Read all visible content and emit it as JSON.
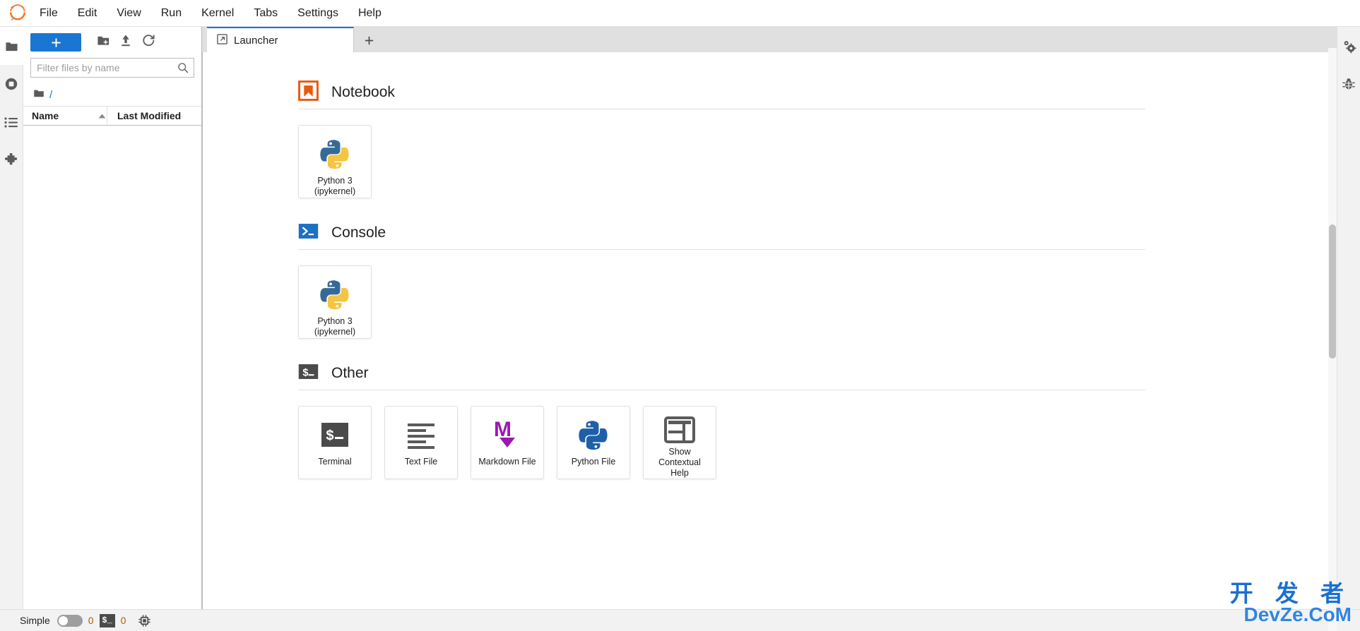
{
  "app": {
    "logo_icon": "jupyter-logo",
    "menu": [
      {
        "label": "File",
        "name": "menu-file"
      },
      {
        "label": "Edit",
        "name": "menu-edit"
      },
      {
        "label": "View",
        "name": "menu-view"
      },
      {
        "label": "Run",
        "name": "menu-run"
      },
      {
        "label": "Kernel",
        "name": "menu-kernel"
      },
      {
        "label": "Tabs",
        "name": "menu-tabs"
      },
      {
        "label": "Settings",
        "name": "menu-settings"
      },
      {
        "label": "Help",
        "name": "menu-help"
      }
    ]
  },
  "left_activity_bar": {
    "items": [
      {
        "icon": "folder-icon",
        "name": "sidebar-item-file-browser",
        "active": true
      },
      {
        "icon": "stop-circle-icon",
        "name": "sidebar-item-running-sessions",
        "active": false
      },
      {
        "icon": "list-icon",
        "name": "sidebar-item-commands",
        "active": false
      },
      {
        "icon": "puzzle-icon",
        "name": "sidebar-item-extension-manager",
        "active": false
      }
    ]
  },
  "file_browser": {
    "toolbar": {
      "new_launcher_label": "+",
      "new_folder_icon": "new-folder-icon",
      "upload_icon": "upload-icon",
      "refresh_icon": "refresh-icon"
    },
    "filter": {
      "placeholder": "Filter files by name",
      "value": "",
      "search_icon": "search-icon"
    },
    "breadcrumb": {
      "root_icon": "folder-icon",
      "path": "/"
    },
    "columns": {
      "name": "Name",
      "last_modified": "Last Modified",
      "sort_indicator": "sort-ascending-icon"
    },
    "rows": []
  },
  "tabs": {
    "items": [
      {
        "label": "Launcher",
        "icon": "launcher-icon",
        "name": "tab-launcher",
        "active": true
      }
    ],
    "add_tab_label": "+"
  },
  "launcher": {
    "sections": [
      {
        "title": "Notebook",
        "icon": "notebook-icon",
        "name": "launcher-section-notebook",
        "cards": [
          {
            "label": "Python 3\n(ipykernel)",
            "line1": "Python 3",
            "line2": "(ipykernel)",
            "icon": "python-logo-icon",
            "name": "launcher-card-notebook-python3"
          }
        ]
      },
      {
        "title": "Console",
        "icon": "console-icon",
        "name": "launcher-section-console",
        "cards": [
          {
            "label": "Python 3\n(ipykernel)",
            "line1": "Python 3",
            "line2": "(ipykernel)",
            "icon": "python-logo-icon",
            "name": "launcher-card-console-python3"
          }
        ]
      },
      {
        "title": "Other",
        "icon": "terminal-icon",
        "name": "launcher-section-other",
        "cards": [
          {
            "label": "Terminal",
            "line1": "Terminal",
            "line2": "",
            "icon": "terminal-icon",
            "name": "launcher-card-terminal"
          },
          {
            "label": "Text File",
            "line1": "Text File",
            "line2": "",
            "icon": "text-file-icon",
            "name": "launcher-card-text-file"
          },
          {
            "label": "Markdown File",
            "line1": "Markdown File",
            "line2": "",
            "icon": "markdown-icon",
            "name": "launcher-card-markdown-file"
          },
          {
            "label": "Python File",
            "line1": "Python File",
            "line2": "",
            "icon": "python-logo-icon",
            "name": "launcher-card-python-file"
          },
          {
            "label": "Show Contextual Help",
            "line1": "Show Contextual",
            "line2": "Help",
            "icon": "contextual-help-icon",
            "name": "launcher-card-contextual-help"
          }
        ]
      }
    ]
  },
  "right_activity_bar": {
    "items": [
      {
        "icon": "gears-icon",
        "name": "sidebar-item-property-inspector"
      },
      {
        "icon": "bug-icon",
        "name": "sidebar-item-debugger"
      }
    ]
  },
  "status_bar": {
    "mode_label": "Simple",
    "mode_enabled": false,
    "terminal_count": "0",
    "terminal_badge": "$_",
    "kernel_count": "0",
    "kernel_icon": "kernel-chip-icon"
  },
  "watermark": {
    "line_cn": "开 发 者",
    "line_en": "DevZe.CoM"
  },
  "colors": {
    "accent": "#1976d2",
    "notebook_orange": "#e8590c",
    "markdown_purple": "#9b19b0",
    "python_blue": "#2b5b84",
    "python_yellow": "#f5c542",
    "terminal_dark": "#4a4a4a"
  }
}
